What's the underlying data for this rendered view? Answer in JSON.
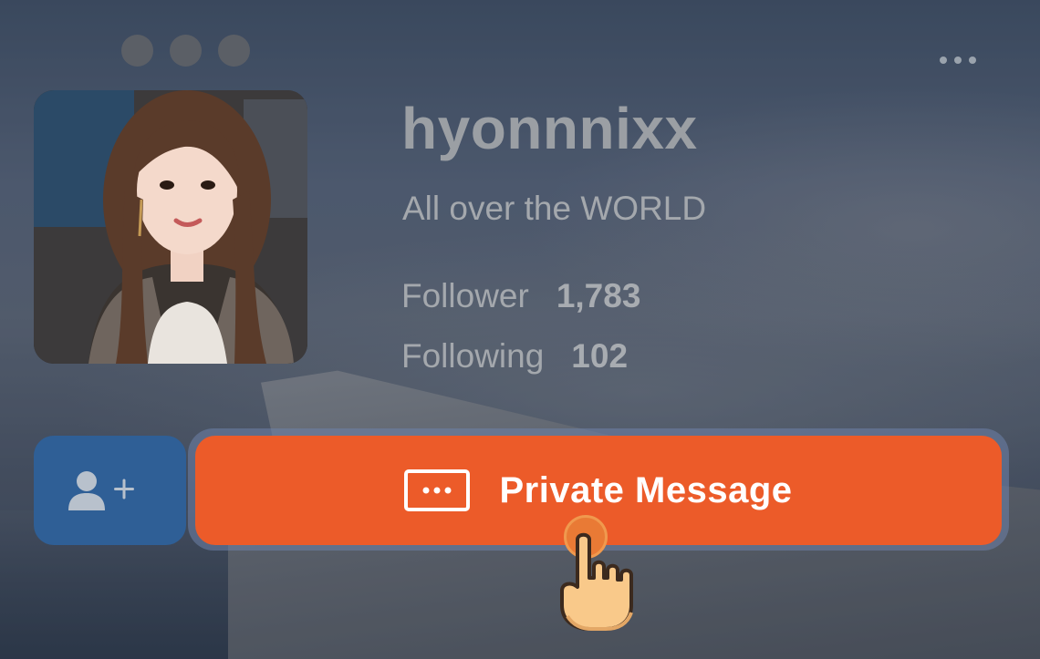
{
  "window": {
    "controls": [
      "dot",
      "dot",
      "dot"
    ],
    "more_icon": "ellipsis-horizontal"
  },
  "profile": {
    "username": "hyonnnixx",
    "bio": "All over the WORLD",
    "avatar_alt": "profile photo",
    "stats": {
      "follower_label": "Follower",
      "follower_count": "1,783",
      "following_label": "Following",
      "following_count": "102"
    }
  },
  "actions": {
    "follow_icon": "add-user-icon",
    "message_label": "Private Message",
    "message_icon": "chat-bubble-icon"
  },
  "colors": {
    "follow_button": "#2f5f96",
    "message_button": "#ec5b29",
    "username": "#9b9fa4"
  }
}
